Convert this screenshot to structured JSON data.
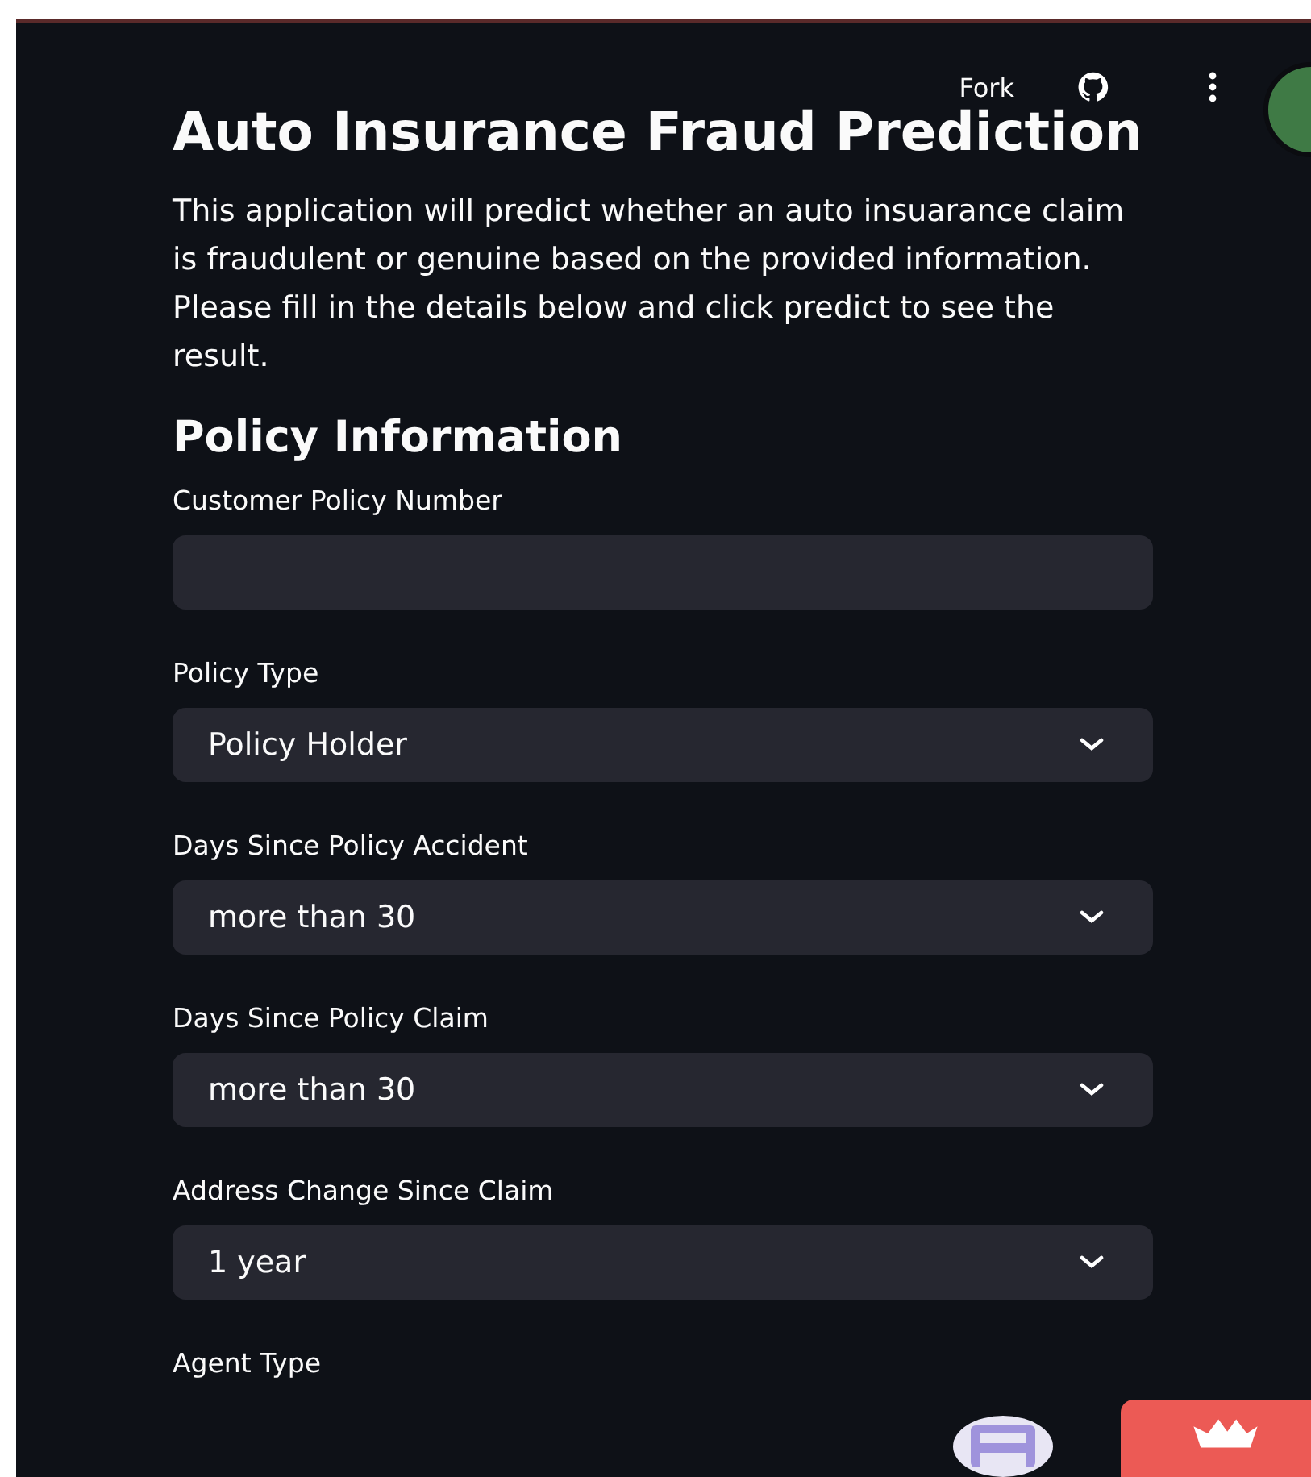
{
  "toolbar": {
    "fork_label": "Fork"
  },
  "title": "Auto Insurance Fraud Prediction",
  "intro": "This application will predict whether an auto insuarance claim is fraudulent or genuine based on the provided information. Please fill in the details below and click predict to see the result.",
  "section": "Policy Information",
  "fields": [
    {
      "kind": "text",
      "label": "Customer Policy Number"
    },
    {
      "kind": "select",
      "label": "Policy Type",
      "value": "Policy Holder"
    },
    {
      "kind": "select",
      "label": "Days Since Policy Accident",
      "value": "more than 30"
    },
    {
      "kind": "select",
      "label": "Days Since Policy Claim",
      "value": "more than 30"
    },
    {
      "kind": "select",
      "label": "Address Change Since Claim",
      "value": "1 year"
    },
    {
      "kind": "label",
      "label": "Agent Type"
    }
  ]
}
